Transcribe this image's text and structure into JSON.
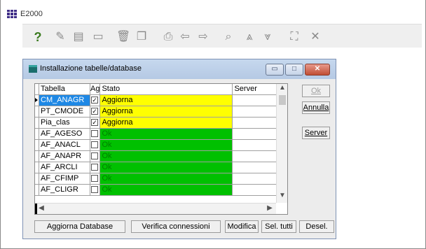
{
  "app": {
    "title": "E2000"
  },
  "toolbar": {
    "buttons": [
      {
        "icon": "help-icon",
        "glyph": "?"
      },
      {
        "icon": "edit-icon",
        "glyph": "✎"
      },
      {
        "icon": "form-icon",
        "glyph": "▤"
      },
      {
        "icon": "save-icon",
        "glyph": "▭"
      },
      {
        "icon": "delete-icon",
        "glyph": "🗑"
      },
      {
        "icon": "copy-icon",
        "glyph": "❐"
      },
      {
        "icon": "print-icon",
        "glyph": "⎙"
      },
      {
        "icon": "arrow-left-icon",
        "glyph": "⇦"
      },
      {
        "icon": "arrow-right-icon",
        "glyph": "⇨"
      },
      {
        "icon": "search-icon",
        "glyph": "⌕"
      },
      {
        "icon": "double-up-icon",
        "glyph": "⩓"
      },
      {
        "icon": "double-down-icon",
        "glyph": "⩔"
      },
      {
        "icon": "binoculars-icon",
        "glyph": "⛶"
      },
      {
        "icon": "tools-icon",
        "glyph": "✕"
      }
    ]
  },
  "dialog": {
    "title": "Installazione tabelle/database",
    "window_buttons": {
      "minimize": "▭",
      "maximize": "□",
      "close": "✕"
    },
    "columns": {
      "tabella": "Tabella",
      "ag": "Ag",
      "stato": "Stato",
      "server": "Server"
    },
    "rows": [
      {
        "tabella": "CM_ANAGR",
        "checked": true,
        "stato": "Aggiorna",
        "status": "yellow",
        "selected": true
      },
      {
        "tabella": "PT_CMODE",
        "checked": true,
        "stato": "Aggiorna",
        "status": "yellow"
      },
      {
        "tabella": "Pia_clas",
        "checked": true,
        "stato": "Aggiorna",
        "status": "yellow"
      },
      {
        "tabella": "AF_AGESO",
        "checked": false,
        "stato": "Ok",
        "status": "green"
      },
      {
        "tabella": "AF_ANACL",
        "checked": false,
        "stato": "Ok",
        "status": "green"
      },
      {
        "tabella": "AF_ANAPR",
        "checked": false,
        "stato": "Ok",
        "status": "green"
      },
      {
        "tabella": "AF_ARCLI",
        "checked": false,
        "stato": "Ok",
        "status": "green"
      },
      {
        "tabella": "AF_CFIMP",
        "checked": false,
        "stato": "Ok",
        "status": "green"
      },
      {
        "tabella": "AF_CLIGR",
        "checked": false,
        "stato": "Ok",
        "status": "green"
      }
    ],
    "side_buttons": {
      "ok": "Ok",
      "annulla": "Annulla",
      "server": "Server"
    },
    "bottom_buttons": {
      "aggiorna": "Aggiorna Database",
      "verifica": "Verifica connessioni",
      "modifica": "Modifica",
      "sel_tutti": "Sel. tutti",
      "desel_tutti": "Desel. tutti"
    }
  },
  "colors": {
    "selection": "#1e88e5",
    "aggiorna": "#ffff00",
    "ok": "#00c000"
  }
}
